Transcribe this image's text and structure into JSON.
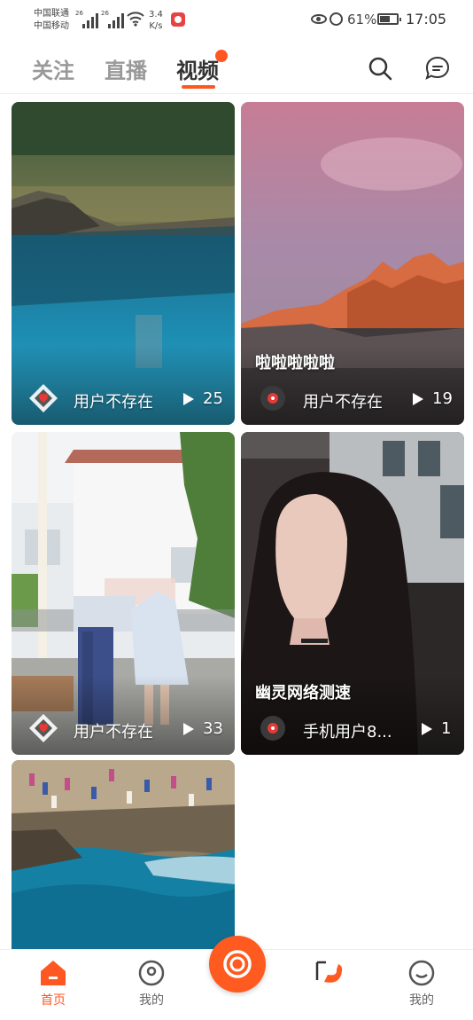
{
  "status_bar": {
    "carrier1": "中国联通",
    "carrier2": "中国移动",
    "net1": "26",
    "net2": "26",
    "speed_value": "3.4",
    "speed_unit": "K/s",
    "battery_percent": "61%",
    "battery_level": 0.61,
    "time": "17:05"
  },
  "top_tabs": [
    {
      "label": "关注",
      "active": false
    },
    {
      "label": "直播",
      "active": false
    },
    {
      "label": "视频",
      "active": true
    }
  ],
  "header_icons": {
    "search": "search-icon",
    "message": "message-icon"
  },
  "cards": [
    {
      "title": "",
      "user": "用户不存在",
      "plays": "25",
      "avatar": "diamond-avatar-icon"
    },
    {
      "title": "啦啦啦啦啦",
      "user": "用户不存在",
      "plays": "19",
      "avatar": "record-avatar-icon"
    },
    {
      "title": "",
      "user": "用户不存在",
      "plays": "33",
      "avatar": "diamond-avatar-icon"
    },
    {
      "title": "幽灵网络测速",
      "user": "手机用户8...",
      "plays": "1",
      "avatar": "record-avatar-icon"
    },
    {
      "title": "",
      "user": "",
      "plays": "",
      "avatar": ""
    }
  ],
  "bottom_nav": [
    {
      "label": "首页",
      "icon": "home-icon",
      "active": true
    },
    {
      "label": "我的",
      "icon": "profile-icon",
      "active": false
    },
    {
      "label": "",
      "icon": "camera-record-icon",
      "active": false
    },
    {
      "label": "",
      "icon": "wallet-icon",
      "active": false
    },
    {
      "label": "我的",
      "icon": "smile-icon",
      "active": false
    }
  ],
  "colors": {
    "accent": "#ff5722",
    "tab_inactive": "#999999",
    "tab_active": "#333333"
  }
}
